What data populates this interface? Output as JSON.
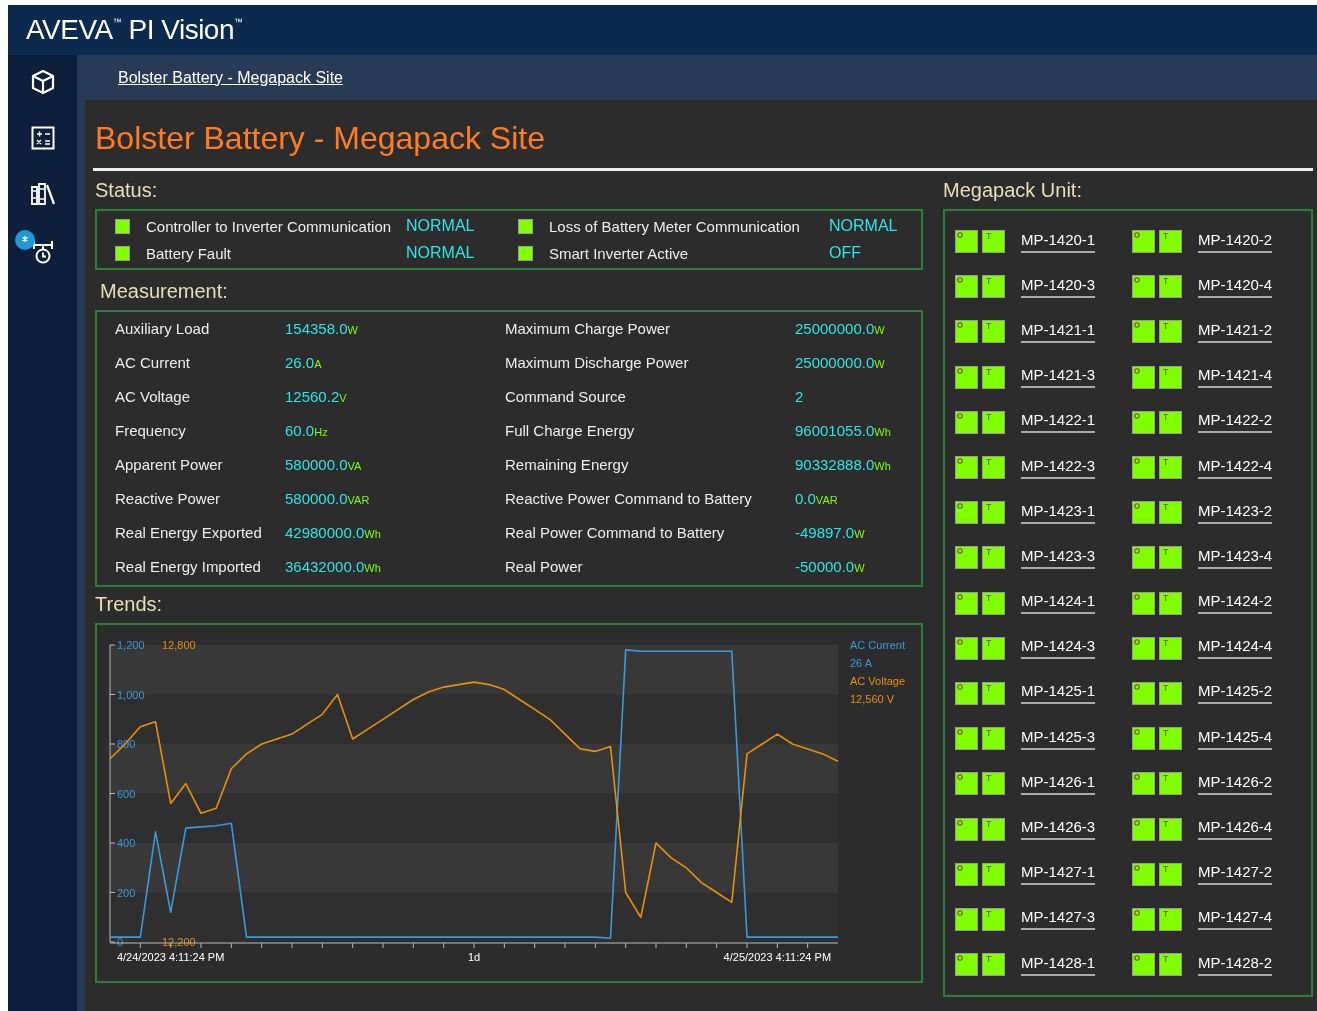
{
  "header": {
    "brand": "AVEVA",
    "brand_mark": "™",
    "product": "PI Vision",
    "product_mark": "™"
  },
  "sidebar": {
    "items": [
      {
        "kind": "cube",
        "selected": false
      },
      {
        "kind": "calculator",
        "selected": false
      },
      {
        "kind": "library",
        "selected": false
      },
      {
        "kind": "hierarchy",
        "selected": false,
        "badge": true
      }
    ]
  },
  "breadcrumb": "Bolster Battery - Megapack Site",
  "title": "Bolster Battery - Megapack Site",
  "status": {
    "heading": "Status:",
    "items": [
      {
        "label": "Controller to Inverter Communication",
        "value": "NORMAL",
        "color": "#7fff00"
      },
      {
        "label": "Loss of Battery Meter Communication",
        "value": "NORMAL",
        "color": "#7fff00"
      },
      {
        "label": "Battery Fault",
        "value": "NORMAL",
        "color": "#7fff00"
      },
      {
        "label": "Smart Inverter Active",
        "value": "OFF",
        "color": "#7fff00"
      }
    ]
  },
  "measurement": {
    "heading": "Measurement:",
    "rows": [
      {
        "label": "Auxiliary Load",
        "value": "154358.0",
        "unit": "W"
      },
      {
        "label": "Maximum Charge Power",
        "value": "25000000.0",
        "unit": "W"
      },
      {
        "label": "AC Current",
        "value": "26.0",
        "unit": "A"
      },
      {
        "label": "Maximum Discharge Power",
        "value": "25000000.0",
        "unit": "W"
      },
      {
        "label": "AC Voltage",
        "value": "12560.2",
        "unit": "V"
      },
      {
        "label": "Command Source",
        "value": "2"
      },
      {
        "label": "Frequency",
        "value": "60.0",
        "unit": "Hz"
      },
      {
        "label": "Full Charge Energy",
        "value": "96001055.0",
        "unit": "Wh"
      },
      {
        "label": "Apparent Power",
        "value": "580000.0",
        "unit": "VA"
      },
      {
        "label": "Remaining Energy",
        "value": "90332888.0",
        "unit": "Wh"
      },
      {
        "label": "Reactive Power",
        "value": "580000.0",
        "unit": "VAR"
      },
      {
        "label": "Reactive Power Command to Battery",
        "value": "0.0",
        "unit": "VAR"
      },
      {
        "label": "Real Energy Exported",
        "value": "42980000.0",
        "unit": "Wh"
      },
      {
        "label": "Real Power Command to Battery",
        "value": "-49897.0",
        "unit": "W"
      },
      {
        "label": "Real Energy Imported",
        "value": "36432000.0",
        "unit": "Wh"
      },
      {
        "label": "Real Power",
        "value": "-50000.0",
        "unit": "W"
      }
    ]
  },
  "trends": {
    "heading": "Trends:",
    "legend_readings": [
      "26 A",
      "12,560 V"
    ],
    "span_label": "1d",
    "chart_data": {
      "type": "line",
      "categories": [
        null,
        null,
        null,
        null,
        "4/24/2023 4:11:24 PM",
        null,
        null,
        null,
        null,
        null,
        null,
        null,
        null,
        null,
        null,
        null,
        null,
        null,
        null,
        null,
        null,
        null,
        null,
        null,
        null,
        null,
        null,
        null,
        null,
        null,
        null,
        null,
        null,
        null,
        null,
        null,
        null,
        null,
        null,
        null,
        null,
        null,
        null,
        null,
        "4/25/2023 4:11:24 PM",
        null,
        null,
        null,
        null
      ],
      "ylim": [
        0,
        1200
      ],
      "yticks": [
        {
          "value": 0,
          "label": "0"
        },
        {
          "value": 200,
          "label": "200"
        },
        {
          "value": 400,
          "label": "400"
        },
        {
          "value": 600,
          "label": "600"
        },
        {
          "value": 800,
          "label": "800"
        },
        {
          "value": 1000,
          "label": "1,000"
        },
        {
          "value": 1200,
          "label": "1,200"
        }
      ],
      "y2lim": [
        12200,
        12800
      ],
      "y2ticks": [
        {
          "value": 12200,
          "label": "12,200"
        },
        {
          "value": 12800,
          "label": "12,800"
        }
      ],
      "series": [
        {
          "name": "AC Current",
          "color": "#3a9ad9",
          "values": [
            20,
            20,
            20,
            445,
            120,
            460,
            465,
            470,
            480,
            20,
            20,
            20,
            20,
            20,
            20,
            20,
            20,
            20,
            20,
            20,
            20,
            20,
            20,
            20,
            20,
            20,
            20,
            20,
            20,
            20,
            20,
            20,
            20,
            15,
            1180,
            1175,
            1175,
            1175,
            1175,
            1175,
            1175,
            1175,
            20,
            20,
            20,
            20,
            20,
            20,
            20
          ]
        },
        {
          "name": "AC Voltage",
          "color": "#e8900c",
          "axis": "y2",
          "values": [
            12570,
            12600,
            12635,
            12645,
            12480,
            12520,
            12460,
            12470,
            12550,
            12580,
            12600,
            12610,
            12620,
            12640,
            12660,
            12700,
            12610,
            12630,
            12650,
            12670,
            12690,
            12705,
            12715,
            12720,
            12725,
            12720,
            12710,
            12690,
            12670,
            12650,
            12620,
            12590,
            12585,
            12595,
            12300,
            12250,
            12400,
            12370,
            12350,
            12320,
            12300,
            12280,
            12580,
            12600,
            12620,
            12600,
            12590,
            12580,
            12565
          ]
        }
      ]
    }
  },
  "megapack": {
    "heading": "Megapack Unit:",
    "units": [
      {
        "name": "MP-1420-1",
        "tag": "T"
      },
      {
        "name": "MP-1420-2",
        "tag": "T"
      },
      {
        "name": "MP-1420-3",
        "tag": "T"
      },
      {
        "name": "MP-1420-4",
        "tag": "T"
      },
      {
        "name": "MP-1421-1",
        "tag": "T"
      },
      {
        "name": "MP-1421-2",
        "tag": "T"
      },
      {
        "name": "MP-1421-3",
        "tag": "T"
      },
      {
        "name": "MP-1421-4",
        "tag": "T"
      },
      {
        "name": "MP-1422-1",
        "tag": "T"
      },
      {
        "name": "MP-1422-2",
        "tag": "T"
      },
      {
        "name": "MP-1422-3",
        "tag": "T"
      },
      {
        "name": "MP-1422-4",
        "tag": "T"
      },
      {
        "name": "MP-1423-1",
        "tag": "T"
      },
      {
        "name": "MP-1423-2",
        "tag": "T"
      },
      {
        "name": "MP-1423-3",
        "tag": "T"
      },
      {
        "name": "MP-1423-4",
        "tag": "T"
      },
      {
        "name": "MP-1424-1",
        "tag": "T"
      },
      {
        "name": "MP-1424-2",
        "tag": "T"
      },
      {
        "name": "MP-1424-3",
        "tag": "T"
      },
      {
        "name": "MP-1424-4",
        "tag": "T"
      },
      {
        "name": "MP-1425-1",
        "tag": "T"
      },
      {
        "name": "MP-1425-2",
        "tag": "T"
      },
      {
        "name": "MP-1425-3",
        "tag": "T"
      },
      {
        "name": "MP-1425-4",
        "tag": "T"
      },
      {
        "name": "MP-1426-1",
        "tag": "T"
      },
      {
        "name": "MP-1426-2",
        "tag": "T"
      },
      {
        "name": "MP-1426-3",
        "tag": "T"
      },
      {
        "name": "MP-1426-4",
        "tag": "T"
      },
      {
        "name": "MP-1427-1",
        "tag": "T"
      },
      {
        "name": "MP-1427-2",
        "tag": "T"
      },
      {
        "name": "MP-1427-3",
        "tag": "T"
      },
      {
        "name": "MP-1427-4",
        "tag": "T"
      },
      {
        "name": "MP-1428-1",
        "tag": "T"
      },
      {
        "name": "MP-1428-2",
        "tag": "T"
      }
    ]
  }
}
